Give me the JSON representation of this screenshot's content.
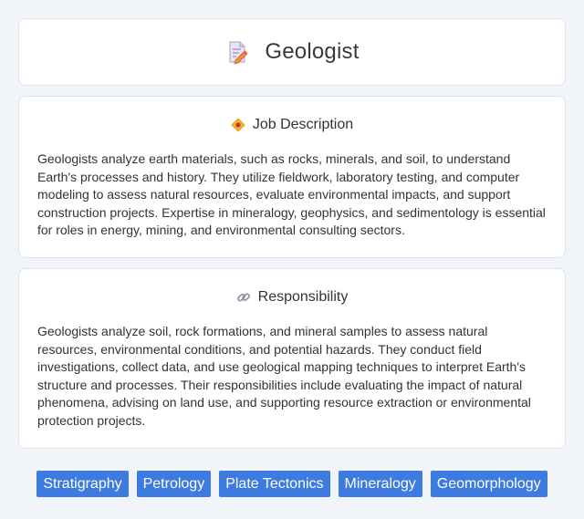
{
  "header": {
    "title": "Geologist",
    "icon": "document-edit-icon"
  },
  "job_description": {
    "heading": "Job Description",
    "icon": "diamond-badge-icon",
    "text": "Geologists analyze earth materials, such as rocks, minerals, and soil, to understand Earth's processes and history. They utilize fieldwork, laboratory testing, and computer modeling to assess natural resources, evaluate environmental impacts, and support construction projects. Expertise in mineralogy, geophysics, and sedimentology is essential for roles in energy, mining, and environmental consulting sectors."
  },
  "responsibility": {
    "heading": "Responsibility",
    "icon": "link-icon",
    "text": "Geologists analyze soil, rock formations, and mineral samples to assess natural resources, environmental conditions, and potential hazards. They conduct field investigations, collect data, and use geological mapping techniques to interpret Earth's structure and processes. Their responsibilities include evaluating the impact of natural phenomena, advising on land use, and supporting resource extraction or environmental protection projects."
  },
  "tags": [
    "Stratigraphy",
    "Petrology",
    "Plate Tectonics",
    "Mineralogy",
    "Geomorphology"
  ],
  "colors": {
    "background": "#f1f4f9",
    "card": "#ffffff",
    "tag": "#3d7be0",
    "tag_text": "#ffffff",
    "text": "#333333"
  }
}
